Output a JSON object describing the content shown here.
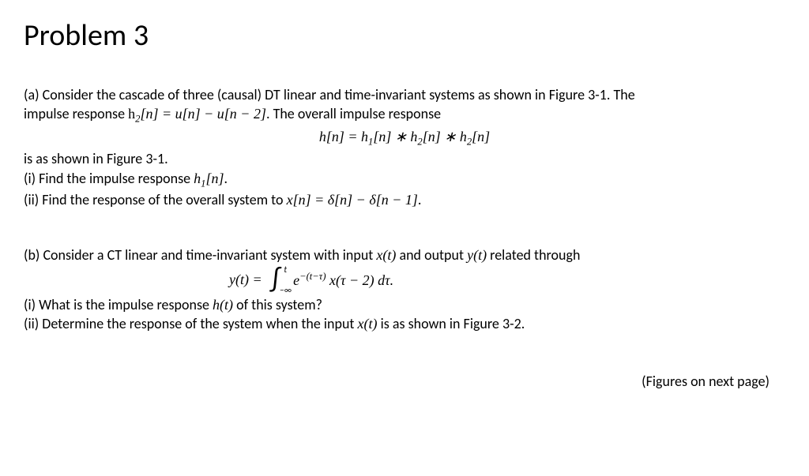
{
  "title": "Problem 3",
  "partA": {
    "intro1": "(a) Consider the cascade of three (causal) DT linear and time-invariant systems as shown in Figure 3-1. The",
    "intro2_prefix": "impulse response ",
    "h2_def": "h₂[n] = u[n] − u[n − 2]",
    "intro2_suffix": ". The overall impulse response",
    "equation": "h[n] = h₁[n] ∗ h₂[n] ∗ h₂[n]",
    "intro3": "is as shown in Figure 3-1.",
    "item_i_prefix": "(i) Find the impulse response ",
    "item_i_math": "h₁[n]",
    "item_i_suffix": ".",
    "item_ii_prefix": "(ii) Find the response of the overall system to ",
    "item_ii_math": "x[n] = δ[n] − δ[n − 1]",
    "item_ii_suffix": "."
  },
  "partB": {
    "intro_prefix": "(b) Consider a CT linear and time-invariant system with input ",
    "xt": "x(t)",
    "intro_mid": " and output ",
    "yt": "y(t)",
    "intro_suffix": " related through",
    "eq_lhs": "y(t) = ",
    "int_upper": "t",
    "int_lower": "−∞",
    "eq_integrand": "e⁻⁽ᵗ⁻τ⁾ x(τ − 2) dτ.",
    "item_i_prefix": "(i) What is the impulse response ",
    "item_i_math": "h(t)",
    "item_i_suffix": " of this system?",
    "item_ii_prefix": "(ii) Determine the response of the system when the input ",
    "item_ii_math": "x(t)",
    "item_ii_suffix": " is as shown in Figure 3-2."
  },
  "footer": "(Figures on next page)"
}
